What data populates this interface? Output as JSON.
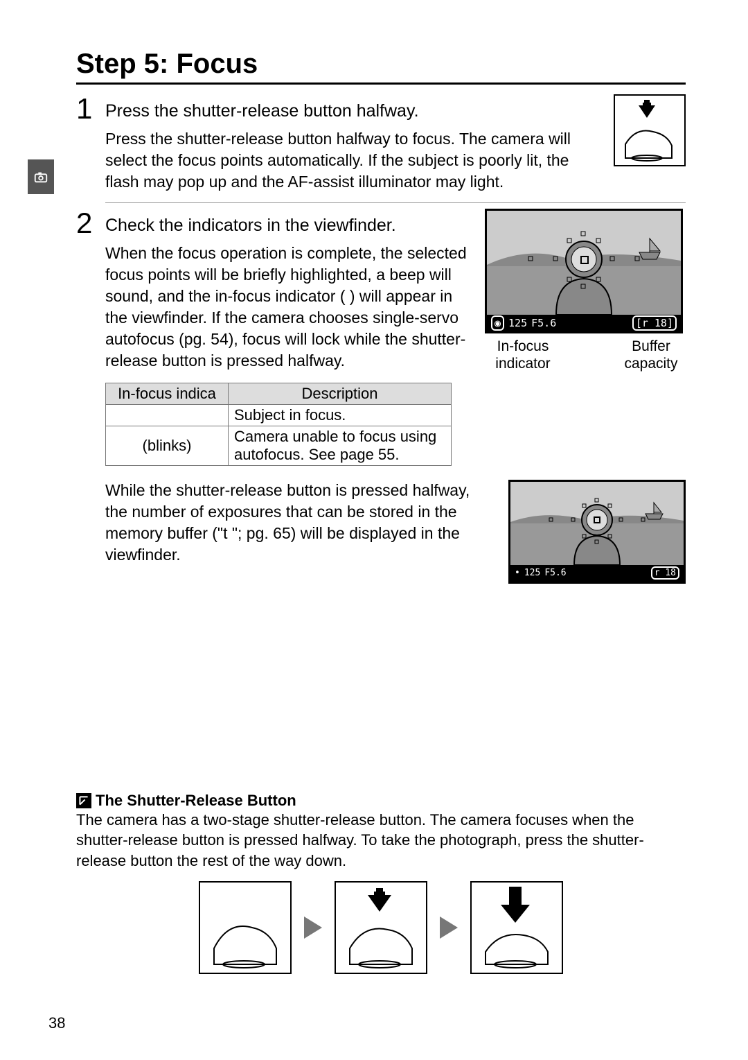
{
  "title": "Step 5: Focus",
  "step1": {
    "num": "1",
    "head": "Press the shutter-release button halfway.",
    "desc": "Press the shutter-release button halfway to focus.  The camera will select the focus points automatically.  If the subject is poorly lit, the flash may pop up and the AF-assist illuminator may light."
  },
  "step2": {
    "num": "2",
    "head": "Check the indicators in the viewfinder.",
    "desc": "When the focus operation is complete, the selected focus points will be briefly highlighted, a beep will sound, and the in-focus indicator (    ) will appear in the viewfinder.  If the camera chooses single-servo autofocus (pg. 54), focus will lock while the shutter-release button is pressed halfway."
  },
  "viewfinder_bar": {
    "shutter": "125",
    "aperture": "F5.6",
    "buffer": "[r 18]"
  },
  "vf_labels": {
    "left": "In-focus indicator",
    "right": "Buffer capacity"
  },
  "table": {
    "header": [
      "In-focus indica",
      "Description"
    ],
    "rows": [
      {
        "indicator": "",
        "desc": "Subject in focus."
      },
      {
        "indicator": "(blinks)",
        "desc": "Camera unable to focus using autofocus.  See page 55."
      }
    ]
  },
  "buffer_para": "While the shutter-release button is pressed halfway, the number of exposures that can be stored in the memory buffer (\"t  \"; pg. 65) will be displayed in the viewfinder.",
  "viewfinder_bar2": {
    "shutter": "125",
    "aperture": "F5.6",
    "buffer": "r 18"
  },
  "note": {
    "title": "The Shutter-Release Button",
    "body": "The camera has a two-stage shutter-release button.  The camera focuses when the shutter-release button is pressed halfway.  To take the photograph, press the shutter-release button the rest of the way down."
  },
  "page_number": "38"
}
